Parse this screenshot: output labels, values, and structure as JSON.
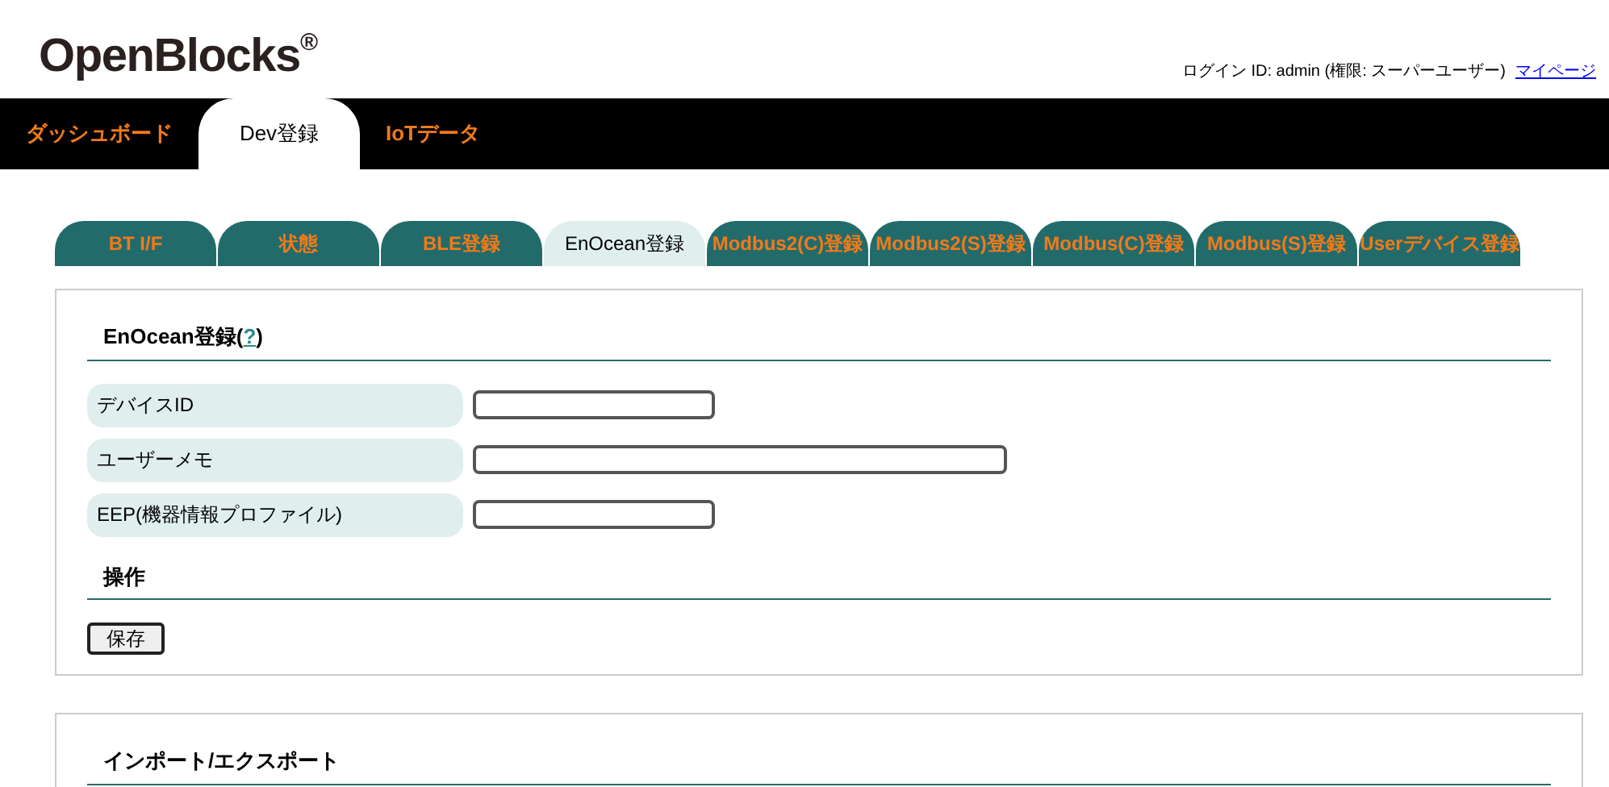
{
  "logo": {
    "text": "OpenBlocks",
    "mark": "®"
  },
  "login": {
    "text": "ログイン ID: admin (権限: スーパーユーザー)",
    "link": "マイページ"
  },
  "nav_tabs": [
    {
      "label": "ダッシュボード",
      "selected": false
    },
    {
      "label": "Dev登録",
      "selected": true
    },
    {
      "label": "IoTデータ",
      "selected": false
    }
  ],
  "sub_tabs": [
    {
      "label": "BT I/F",
      "selected": false
    },
    {
      "label": "状態",
      "selected": false
    },
    {
      "label": "BLE登録",
      "selected": false
    },
    {
      "label": "EnOcean登録",
      "selected": true
    },
    {
      "label": "Modbus2(C)登録",
      "selected": false
    },
    {
      "label": "Modbus2(S)登録",
      "selected": false
    },
    {
      "label": "Modbus(C)登録",
      "selected": false
    },
    {
      "label": "Modbus(S)登録",
      "selected": false
    },
    {
      "label": "Userデバイス登録",
      "selected": false
    }
  ],
  "form": {
    "title_parts": [
      "EnOcean登録(",
      "?",
      ")"
    ],
    "fields": [
      {
        "label": "デバイスID",
        "kind": "short"
      },
      {
        "label": "ユーザーメモ",
        "kind": "long"
      },
      {
        "label": "EEP(機器情報プロファイル)",
        "kind": "short"
      }
    ],
    "actions_title": "操作",
    "save_button": "保存"
  },
  "import_export": {
    "title": "インポート/エクスポート"
  }
}
